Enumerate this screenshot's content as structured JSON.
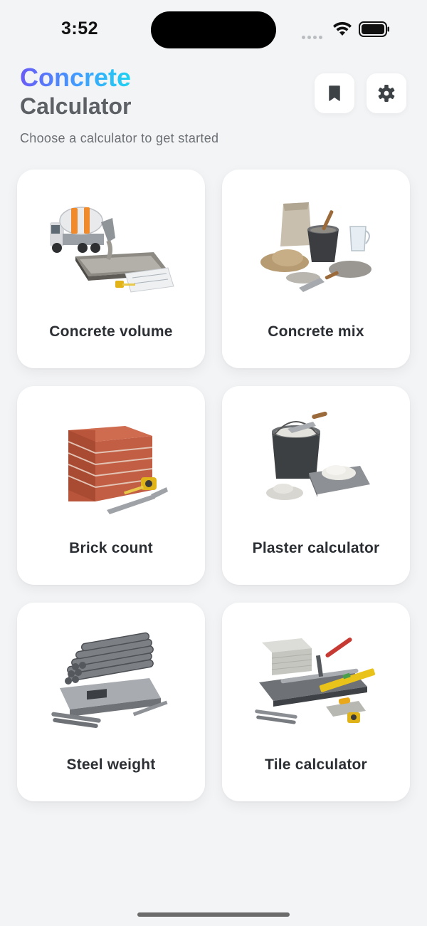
{
  "status_bar": {
    "time": "3:52"
  },
  "header": {
    "title_line1": "Concrete",
    "title_line2": "Calculator",
    "subtitle": "Choose a calculator to get started",
    "bookmark_icon": "bookmark-icon",
    "settings_icon": "gear-icon"
  },
  "calculators": [
    {
      "label": "Concrete volume",
      "icon": "concrete-mixer-truck-icon"
    },
    {
      "label": "Concrete mix",
      "icon": "cement-bag-bucket-icon"
    },
    {
      "label": "Brick count",
      "icon": "brick-stack-icon"
    },
    {
      "label": "Plaster calculator",
      "icon": "plaster-bucket-icon"
    },
    {
      "label": "Steel weight",
      "icon": "rebar-scale-icon"
    },
    {
      "label": "Tile calculator",
      "icon": "tile-cutter-icon"
    }
  ],
  "colors": {
    "background": "#f3f4f6",
    "brand_gradient_start": "#6a5cf6",
    "brand_gradient_end": "#1fd3f0",
    "text_dark": "#2b2f33",
    "text_muted": "#6b6f73"
  }
}
